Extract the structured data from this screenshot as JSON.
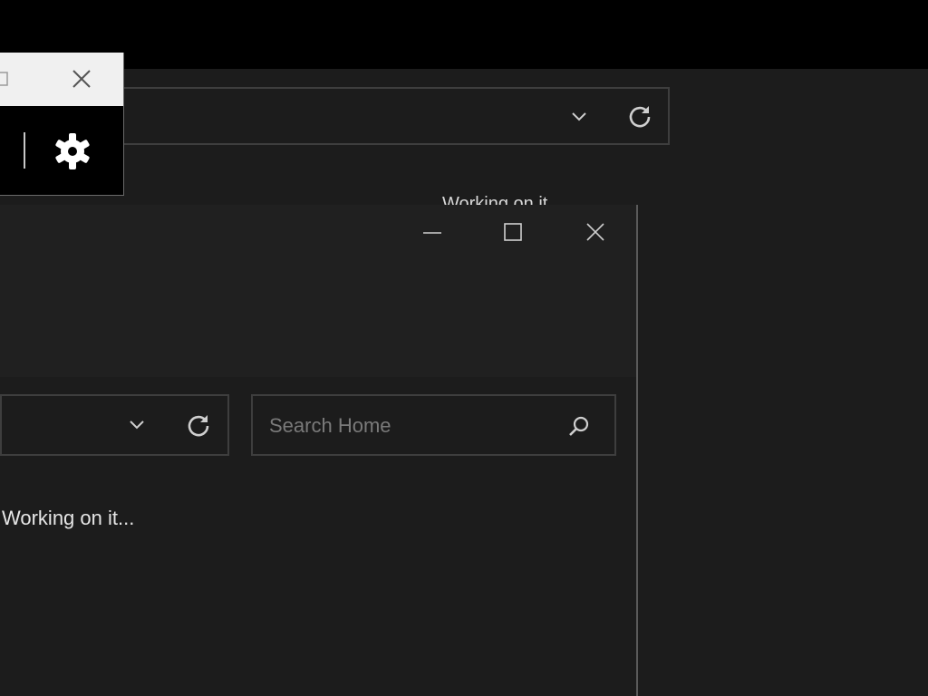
{
  "back_window": {
    "status_text": "Working on it...",
    "address_dropdown_icon": "chevron-down-icon",
    "refresh_icon": "refresh-icon"
  },
  "popup": {
    "close_icon": "close-icon",
    "settings_icon": "gear-icon"
  },
  "front_window": {
    "minimize_icon": "minimize-icon",
    "maximize_icon": "maximize-icon",
    "close_icon": "close-icon",
    "address_dropdown_icon": "chevron-down-icon",
    "refresh_icon": "refresh-icon",
    "search": {
      "placeholder": "Search Home",
      "icon": "search-icon"
    },
    "status_text": "Working on it..."
  },
  "colors": {
    "window_bg": "#1c1c1c",
    "titlebar_bg": "#202020",
    "border": "#3e3e3e",
    "desktop_bg": "#000000"
  }
}
